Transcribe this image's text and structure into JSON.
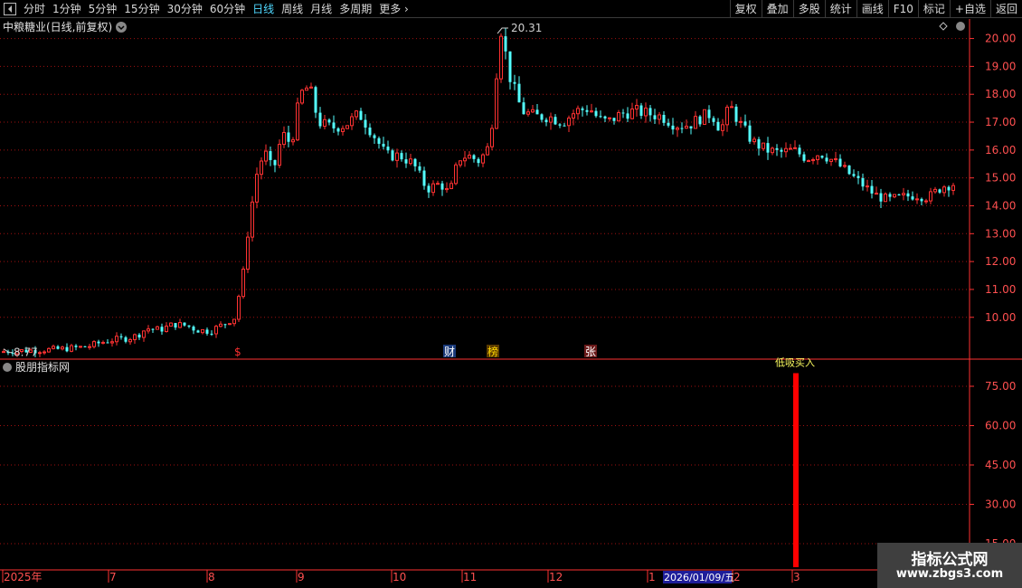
{
  "toolbar": {
    "periods": [
      "分时",
      "1分钟",
      "5分钟",
      "15分钟",
      "30分钟",
      "60分钟",
      "日线",
      "周线",
      "月线",
      "多周期",
      "更多"
    ],
    "active_index": 6,
    "right_buttons": [
      "复权",
      "叠加",
      "多股",
      "统计",
      "画线",
      "F10",
      "标记",
      "+自选",
      "返回"
    ]
  },
  "stock": {
    "title": "中粮糖业(日线,前复权)"
  },
  "indicator": {
    "title": "股朋指标网",
    "signal_label": "低吸买入"
  },
  "markers": [
    {
      "label": "$",
      "color": "#ff3030"
    },
    {
      "label": "财",
      "color": "#ffffff",
      "bg": "#1a3a7a"
    },
    {
      "label": "榜",
      "color": "#ffd700",
      "bg": "#5a3a00"
    },
    {
      "label": "张",
      "color": "#ffffff",
      "bg": "#6a1a1a"
    }
  ],
  "date_axis": {
    "labels": [
      "2025年",
      "7",
      "8",
      "9",
      "10",
      "11",
      "12",
      "1",
      "2",
      "3"
    ],
    "highlight": "2026/01/09/五"
  },
  "watermark": {
    "title": "指标公式网",
    "url": "www.zbgs3.com"
  },
  "colors": {
    "up": "#ff3232",
    "down": "#54ffff",
    "grid": "#a01010",
    "axis": "#ff3232",
    "label": "#ff5050"
  },
  "chart_data": [
    {
      "type": "candlestick",
      "title": "中粮糖业(日线,前复权)",
      "ylim": [
        8.5,
        20.7
      ],
      "y_ticks": [
        10.0,
        11.0,
        12.0,
        13.0,
        14.0,
        15.0,
        16.0,
        17.0,
        18.0,
        19.0,
        20.0
      ],
      "grid": true,
      "annotations": [
        {
          "label": "20.31",
          "value": 20.31,
          "type": "max"
        },
        {
          "label": "8.77",
          "value": 8.77,
          "type": "min"
        }
      ],
      "path": [
        [
          0,
          8.77
        ],
        [
          20,
          8.8
        ],
        [
          40,
          8.82
        ],
        [
          60,
          8.85
        ],
        [
          80,
          8.9
        ],
        [
          95,
          8.95
        ],
        [
          110,
          9.1
        ],
        [
          125,
          9.2
        ],
        [
          140,
          9.25
        ],
        [
          150,
          9.35
        ],
        [
          160,
          9.6
        ],
        [
          175,
          9.55
        ],
        [
          190,
          9.75
        ],
        [
          205,
          9.7
        ],
        [
          215,
          9.55
        ],
        [
          230,
          9.5
        ],
        [
          245,
          9.75
        ],
        [
          258,
          10.0
        ],
        [
          265,
          11.2
        ],
        [
          272,
          12.8
        ],
        [
          280,
          14.8
        ],
        [
          290,
          16.0
        ],
        [
          300,
          15.2
        ],
        [
          310,
          16.6
        ],
        [
          320,
          16.2
        ],
        [
          330,
          18.0
        ],
        [
          340,
          18.3
        ],
        [
          350,
          17.0
        ],
        [
          365,
          16.8
        ],
        [
          380,
          16.9
        ],
        [
          395,
          17.3
        ],
        [
          410,
          16.6
        ],
        [
          425,
          15.8
        ],
        [
          440,
          15.8
        ],
        [
          455,
          15.5
        ],
        [
          470,
          14.6
        ],
        [
          485,
          14.8
        ],
        [
          495,
          14.4
        ],
        [
          505,
          15.7
        ],
        [
          515,
          15.8
        ],
        [
          528,
          15.6
        ],
        [
          540,
          16.2
        ],
        [
          545,
          18.2
        ],
        [
          552,
          20.3
        ],
        [
          562,
          18.6
        ],
        [
          575,
          17.4
        ],
        [
          590,
          17.2
        ],
        [
          605,
          17.2
        ],
        [
          620,
          17.0
        ],
        [
          635,
          17.4
        ],
        [
          650,
          17.5
        ],
        [
          660,
          17.1
        ],
        [
          670,
          17.0
        ],
        [
          685,
          17.3
        ],
        [
          700,
          17.4
        ],
        [
          715,
          17.3
        ],
        [
          730,
          17.2
        ],
        [
          745,
          16.9
        ],
        [
          760,
          16.9
        ],
        [
          775,
          17.2
        ],
        [
          785,
          17.3
        ],
        [
          795,
          16.7
        ],
        [
          805,
          17.6
        ],
        [
          815,
          17.0
        ],
        [
          830,
          16.3
        ],
        [
          845,
          16.0
        ],
        [
          860,
          15.9
        ],
        [
          875,
          16.0
        ],
        [
          890,
          15.7
        ],
        [
          905,
          15.9
        ],
        [
          920,
          15.6
        ],
        [
          935,
          15.2
        ],
        [
          950,
          14.8
        ],
        [
          965,
          14.4
        ],
        [
          980,
          14.2
        ],
        [
          995,
          14.3
        ],
        [
          1010,
          14.4
        ],
        [
          1025,
          14.3
        ],
        [
          1040,
          14.7
        ],
        [
          1055,
          14.8
        ]
      ]
    },
    {
      "type": "bar",
      "title": "股朋指标网",
      "ylim": [
        5,
        85
      ],
      "y_ticks": [
        15.0,
        30.0,
        45.0,
        60.0,
        75.0
      ],
      "grid": true,
      "series": [
        {
          "name": "低吸买入",
          "values": [
            80
          ]
        }
      ]
    }
  ]
}
